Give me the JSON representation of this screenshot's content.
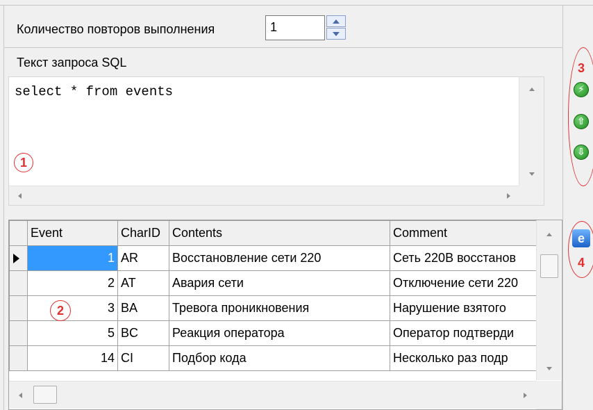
{
  "repeat": {
    "label": "Количество повторов выполнения",
    "value": "1"
  },
  "sql": {
    "label": "Текст запроса SQL",
    "text": "select * from events"
  },
  "toolbar": {
    "icons": [
      "execute-icon",
      "arrow-up-icon",
      "arrow-down-icon",
      "ie-browser-icon"
    ]
  },
  "annotations": {
    "a1": "1",
    "a2": "2",
    "a3": "3",
    "a4": "4"
  },
  "grid": {
    "columns": [
      "Event",
      "CharID",
      "Contents",
      "Comment"
    ],
    "rows": [
      {
        "event": "1",
        "charid": "AR",
        "contents": "Восстановление сети 220",
        "comment": "Сеть 220В восстанов"
      },
      {
        "event": "2",
        "charid": "AT",
        "contents": "Авария сети",
        "comment": "Отключение сети 220"
      },
      {
        "event": "3",
        "charid": "BA",
        "contents": "Тревога проникновения",
        "comment": "Нарушение взятого"
      },
      {
        "event": "5",
        "charid": "BC",
        "contents": "Реакция оператора",
        "comment": "Оператор подтверди"
      },
      {
        "event": "14",
        "charid": "CI",
        "contents": "Подбор кода",
        "comment": "Несколько раз подр"
      }
    ]
  },
  "colors": {
    "selection": "#3399ff",
    "annotation": "#e03030",
    "button_green": "#1e8a1e"
  }
}
